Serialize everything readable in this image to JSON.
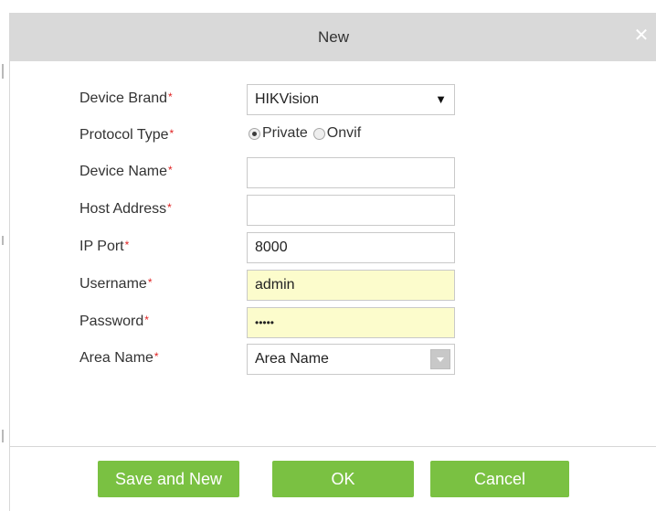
{
  "dialog": {
    "title": "New",
    "close_icon": "close-icon"
  },
  "form": {
    "required_marker": "*",
    "device_brand": {
      "label": "Device Brand",
      "value": "HIKVision",
      "arrow": "▼"
    },
    "protocol_type": {
      "label": "Protocol Type",
      "options": [
        "Private",
        "Onvif"
      ],
      "selected": "Private"
    },
    "device_name": {
      "label": "Device Name",
      "value": ""
    },
    "host_address": {
      "label": "Host Address",
      "value": ""
    },
    "ip_port": {
      "label": "IP Port",
      "value": "8000"
    },
    "username": {
      "label": "Username",
      "value": "admin"
    },
    "password": {
      "label": "Password",
      "value": "•••••"
    },
    "area_name": {
      "label": "Area Name",
      "value": "Area Name"
    }
  },
  "buttons": {
    "save_and_new": "Save and New",
    "ok": "OK",
    "cancel": "Cancel"
  },
  "colors": {
    "button_green": "#7ac142",
    "titlebar_gray": "#d9d9d9",
    "required_red": "#e02020",
    "autofill_yellow": "#fcfccc"
  }
}
